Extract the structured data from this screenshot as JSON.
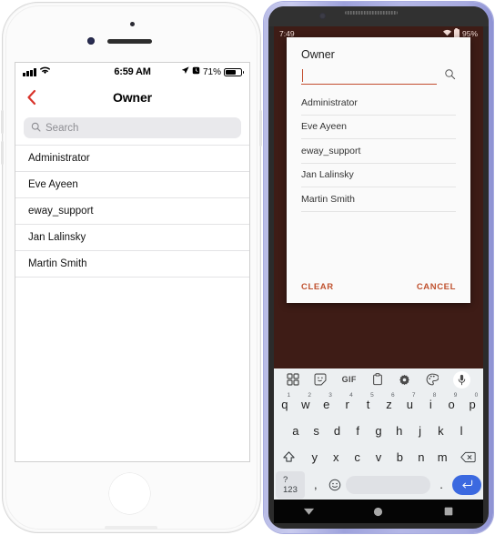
{
  "ios": {
    "status_bar": {
      "signal_icon": "cellular-signal-icon",
      "wifi_icon": "wifi-icon",
      "time": "6:59 AM",
      "location_icon": "location-arrow-icon",
      "alarm_icon": "alarm-clock-icon",
      "battery_percent": "71%",
      "battery_icon": "battery-icon"
    },
    "nav": {
      "back_icon": "chevron-left-icon",
      "back_color": "#d9342b",
      "title": "Owner"
    },
    "search": {
      "icon": "search-icon",
      "placeholder": "Search"
    },
    "list": [
      {
        "label": "Administrator"
      },
      {
        "label": "Eve Ayeen"
      },
      {
        "label": "eway_support"
      },
      {
        "label": "Jan Lalinsky"
      },
      {
        "label": "Martin Smith"
      }
    ]
  },
  "android": {
    "status_bar": {
      "time": "7:49",
      "wifi_icon": "wifi-icon",
      "battery_icon": "battery-icon",
      "battery_percent": "95%",
      "background_color": "#3e1c16"
    },
    "dialog": {
      "title": "Owner",
      "search": {
        "value": "",
        "icon": "search-icon",
        "underline_color": "#c34d2e"
      },
      "list": [
        {
          "label": "Administrator"
        },
        {
          "label": "Eve Ayeen"
        },
        {
          "label": "eway_support"
        },
        {
          "label": "Jan Lalinsky"
        },
        {
          "label": "Martin Smith"
        }
      ],
      "clear_label": "CLEAR",
      "cancel_label": "CANCEL",
      "action_color": "#c0522f"
    },
    "keyboard": {
      "toolbar": [
        {
          "name": "apps-grid-icon",
          "label": ""
        },
        {
          "name": "sticker-icon",
          "label": ""
        },
        {
          "name": "gif-icon",
          "label": "GIF"
        },
        {
          "name": "clipboard-icon",
          "label": ""
        },
        {
          "name": "gear-icon",
          "label": ""
        },
        {
          "name": "palette-icon",
          "label": ""
        },
        {
          "name": "microphone-icon",
          "label": ""
        }
      ],
      "row1": [
        {
          "key": "q",
          "num": "1"
        },
        {
          "key": "w",
          "num": "2"
        },
        {
          "key": "e",
          "num": "3"
        },
        {
          "key": "r",
          "num": "4"
        },
        {
          "key": "t",
          "num": "5"
        },
        {
          "key": "z",
          "num": "6"
        },
        {
          "key": "u",
          "num": "7"
        },
        {
          "key": "i",
          "num": "8"
        },
        {
          "key": "o",
          "num": "9"
        },
        {
          "key": "p",
          "num": "0"
        }
      ],
      "row2": [
        {
          "key": "a"
        },
        {
          "key": "s"
        },
        {
          "key": "d"
        },
        {
          "key": "f"
        },
        {
          "key": "g"
        },
        {
          "key": "h"
        },
        {
          "key": "j"
        },
        {
          "key": "k"
        },
        {
          "key": "l"
        }
      ],
      "row3": [
        {
          "key": "y"
        },
        {
          "key": "x"
        },
        {
          "key": "c"
        },
        {
          "key": "v"
        },
        {
          "key": "b"
        },
        {
          "key": "n"
        },
        {
          "key": "m"
        }
      ],
      "shift_icon": "shift-icon",
      "backspace_icon": "backspace-icon",
      "symbols_label": "?123",
      "comma_label": ",",
      "emoji_icon": "emoji-icon",
      "space_label": "",
      "period_label": ".",
      "enter_icon": "enter-icon",
      "enter_color": "#3b69e0"
    },
    "navbar": {
      "back_icon": "keyboard-down-icon",
      "home_icon": "home-circle-icon",
      "recents_icon": "recents-square-icon"
    }
  }
}
